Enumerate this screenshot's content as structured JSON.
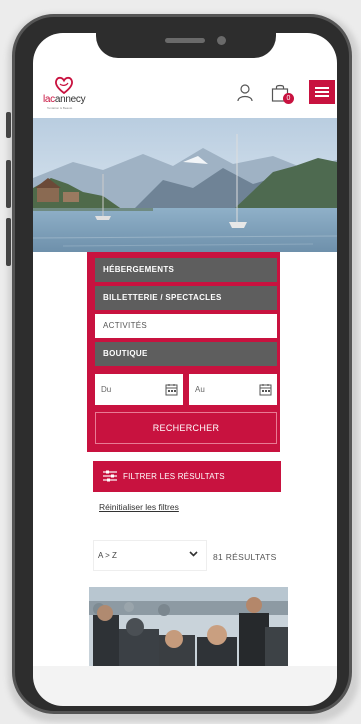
{
  "header": {
    "logo_text_lac": "lac",
    "logo_text_annecy": "annecy",
    "logo_tagline": "Tentation & Beauté",
    "cart_count": "0",
    "brand_color": "#c8123f"
  },
  "search": {
    "categories": [
      {
        "label": "HÉBERGEMENTS",
        "selected": false
      },
      {
        "label": "BILLETTERIE / SPECTACLES",
        "selected": false
      },
      {
        "label": "ACTIVITÉS",
        "selected": true
      },
      {
        "label": "BOUTIQUE",
        "selected": false
      }
    ],
    "date_from_placeholder": "Du",
    "date_to_placeholder": "Au",
    "submit_label": "RECHERCHER"
  },
  "filters": {
    "filter_label": "FILTRER LES RÉSULTATS",
    "reset_label": "Réinitialiser les filtres"
  },
  "sort": {
    "selected": "A > Z",
    "results_count": "81 RÉSULTATS"
  },
  "icons": {
    "user": "user-icon",
    "cart": "shopping-bag-icon",
    "menu": "hamburger-menu-icon",
    "calendar": "calendar-icon",
    "filter": "sliders-icon",
    "chevron": "chevron-down-icon"
  }
}
